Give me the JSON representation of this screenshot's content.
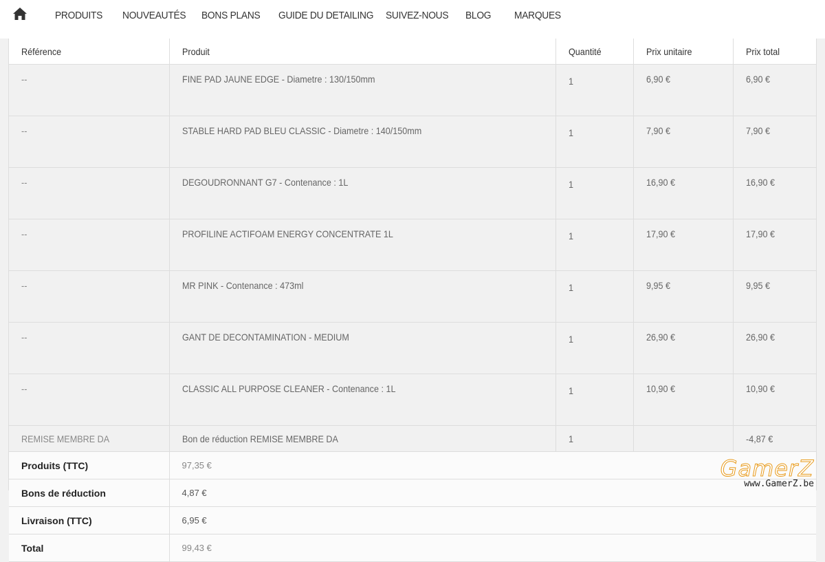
{
  "nav": {
    "home_icon": "home-icon",
    "items": [
      "PRODUITS",
      "NOUVEAUTÉS",
      "BONS PLANS",
      "GUIDE DU DETAILING",
      "SUIVEZ-NOUS",
      "BLOG",
      "MARQUES"
    ]
  },
  "order_table": {
    "headers": [
      "Référence",
      "Produit",
      "Quantité",
      "Prix unitaire",
      "Prix total"
    ],
    "rows": [
      {
        "ref": "--",
        "product": "FINE PAD JAUNE EDGE - Diametre : 130/150mm",
        "qty": "1",
        "unit": "6,90 €",
        "total": "6,90 €"
      },
      {
        "ref": "--",
        "product": "STABLE HARD PAD BLEU CLASSIC - Diametre : 140/150mm",
        "qty": "1",
        "unit": "7,90 €",
        "total": "7,90 €"
      },
      {
        "ref": "--",
        "product": "DEGOUDRONNANT G7 - Contenance : 1L",
        "qty": "1",
        "unit": "16,90 €",
        "total": "16,90 €"
      },
      {
        "ref": "--",
        "product": "PROFILINE ACTIFOAM ENERGY CONCENTRATE 1L",
        "qty": "1",
        "unit": "17,90 €",
        "total": "17,90 €"
      },
      {
        "ref": "--",
        "product": "MR PINK - Contenance : 473ml",
        "qty": "1",
        "unit": "9,95 €",
        "total": "9,95 €"
      },
      {
        "ref": "--",
        "product": "GANT DE DECONTAMINATION - MEDIUM",
        "qty": "1",
        "unit": "26,90 €",
        "total": "26,90 €"
      },
      {
        "ref": "--",
        "product": "CLASSIC ALL PURPOSE CLEANER - Contenance : 1L",
        "qty": "1",
        "unit": "10,90 €",
        "total": "10,90 €"
      }
    ],
    "discount_row": {
      "ref": "REMISE MEMBRE DA",
      "product": "Bon de réduction REMISE MEMBRE DA",
      "qty": "1",
      "unit": "",
      "total": "-4,87 €"
    }
  },
  "summary": [
    {
      "label": "Produits (TTC)",
      "value": "97,35 €"
    },
    {
      "label": "Bons de réduction",
      "value": "4,87 €"
    },
    {
      "label": "Livraison (TTC)",
      "value": "6,95 €"
    },
    {
      "label": "Total",
      "value": "99,43 €"
    }
  ],
  "watermark": {
    "logo": "GamerZ",
    "url": "www.GamerZ.be"
  },
  "colors": {
    "background": "#f1f1f1",
    "border": "#dddddd",
    "watermark_accent": "#e89a1a"
  }
}
